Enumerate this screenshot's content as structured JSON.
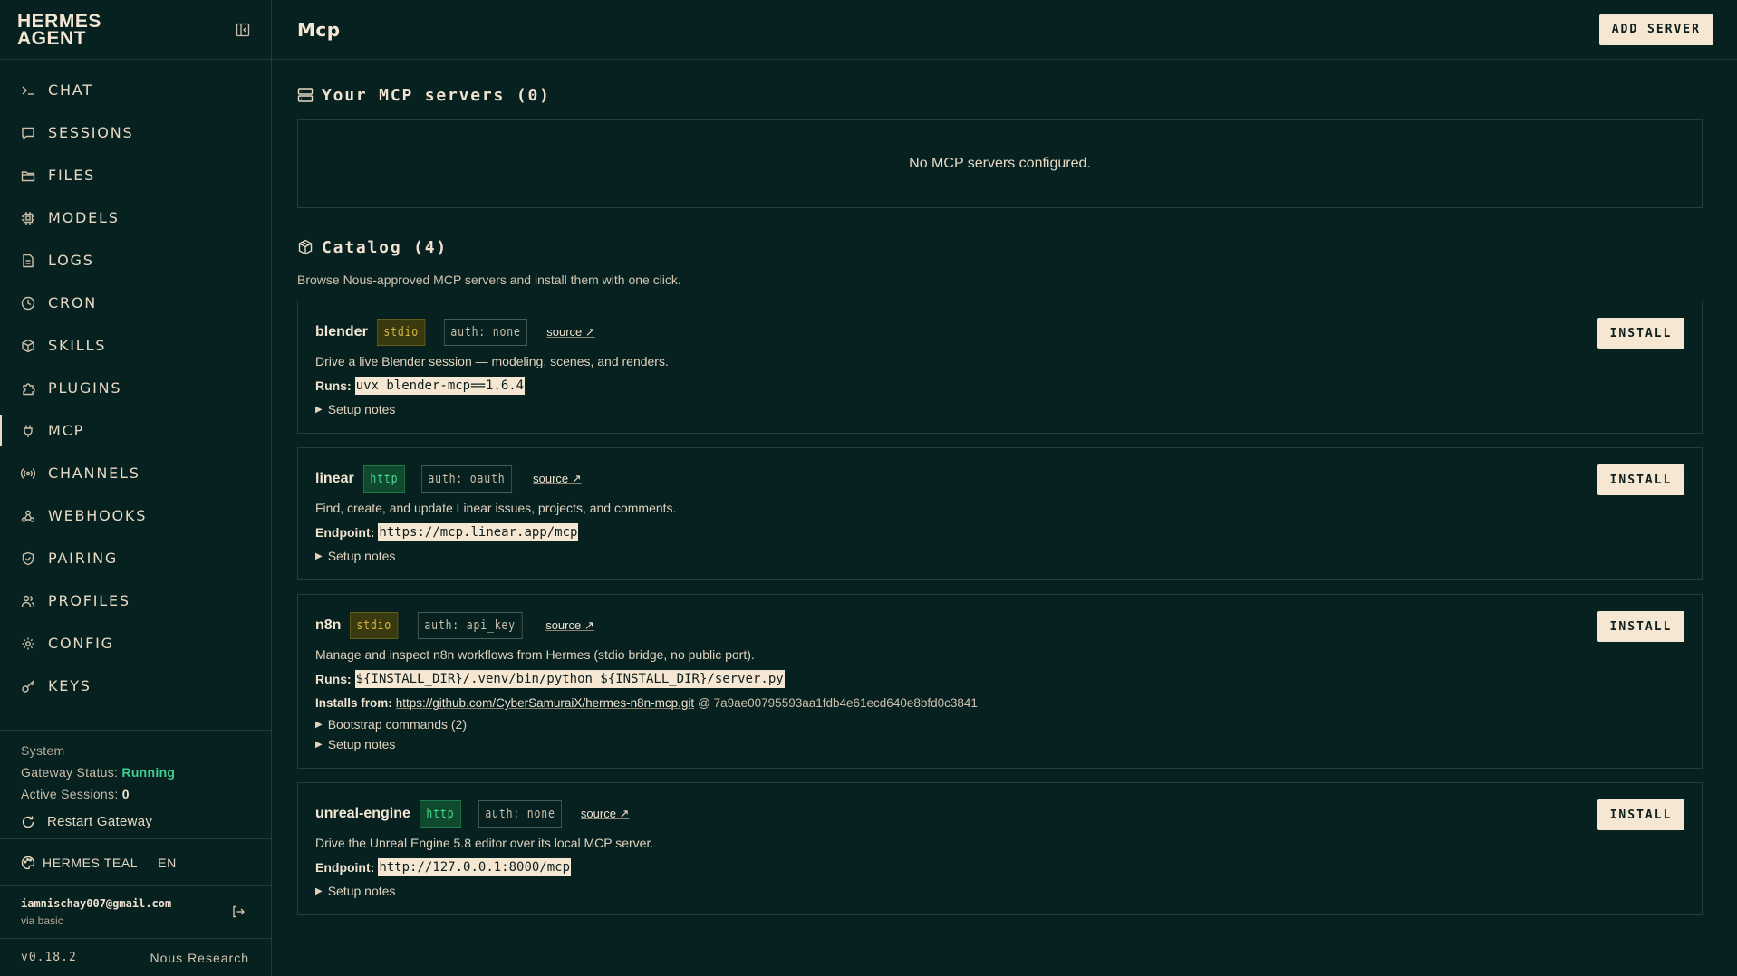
{
  "brand": {
    "title": "HERMES\nAGENT"
  },
  "nav": [
    {
      "label": "CHAT",
      "icon": "terminal-icon",
      "active": false
    },
    {
      "label": "SESSIONS",
      "icon": "message-icon",
      "active": false
    },
    {
      "label": "FILES",
      "icon": "folder-icon",
      "active": false
    },
    {
      "label": "MODELS",
      "icon": "cpu-icon",
      "active": false
    },
    {
      "label": "LOGS",
      "icon": "file-text-icon",
      "active": false
    },
    {
      "label": "CRON",
      "icon": "clock-icon",
      "active": false
    },
    {
      "label": "SKILLS",
      "icon": "package-icon",
      "active": false
    },
    {
      "label": "PLUGINS",
      "icon": "puzzle-icon",
      "active": false
    },
    {
      "label": "MCP",
      "icon": "plug-icon",
      "active": true
    },
    {
      "label": "CHANNELS",
      "icon": "radio-icon",
      "active": false
    },
    {
      "label": "WEBHOOKS",
      "icon": "webhook-icon",
      "active": false
    },
    {
      "label": "PAIRING",
      "icon": "shield-icon",
      "active": false
    },
    {
      "label": "PROFILES",
      "icon": "users-icon",
      "active": false
    },
    {
      "label": "CONFIG",
      "icon": "gear-icon",
      "active": false
    },
    {
      "label": "KEYS",
      "icon": "key-icon",
      "active": false
    }
  ],
  "system": {
    "title": "System",
    "gateway_label": "Gateway Status:",
    "gateway_value": "Running",
    "sessions_label": "Active Sessions:",
    "sessions_value": "0",
    "restart_label": "Restart Gateway"
  },
  "theme": {
    "name": "HERMES TEAL",
    "lang": "EN"
  },
  "user": {
    "email": "iamnischay007@gmail.com",
    "auth": "via basic"
  },
  "footer": {
    "version": "v0.18.2",
    "org": "Nous Research"
  },
  "header": {
    "title": "Mcp",
    "add_button": "ADD SERVER"
  },
  "servers": {
    "title": "Your MCP servers (0)",
    "empty": "No MCP servers configured."
  },
  "catalog": {
    "title": "Catalog (4)",
    "description": "Browse Nous-approved MCP servers and install them with one click.",
    "install_label": "INSTALL",
    "source_label": "source ↗",
    "setup_label": "Setup notes",
    "items": [
      {
        "name": "blender",
        "transport": "stdio",
        "auth": "auth: none",
        "description": "Drive a live Blender session — modeling, scenes, and renders.",
        "line_label": "Runs:",
        "line_value": "uvx blender-mcp==1.6.4"
      },
      {
        "name": "linear",
        "transport": "http",
        "auth": "auth: oauth",
        "description": "Find, create, and update Linear issues, projects, and comments.",
        "line_label": "Endpoint:",
        "line_value": "https://mcp.linear.app/mcp"
      },
      {
        "name": "n8n",
        "transport": "stdio",
        "auth": "auth: api_key",
        "description": "Manage and inspect n8n workflows from Hermes (stdio bridge, no public port).",
        "line_label": "Runs:",
        "line_value": "${INSTALL_DIR}/.venv/bin/python ${INSTALL_DIR}/server.py",
        "installs_label": "Installs from:",
        "installs_url": "https://github.com/CyberSamuraiX/hermes-n8n-mcp.git",
        "installs_commit": "@ 7a9ae00795593aa1fdb4e61ecd640e8bfd0c3841",
        "bootstrap_label": "Bootstrap commands (2)"
      },
      {
        "name": "unreal-engine",
        "transport": "http",
        "auth": "auth: none",
        "description": "Drive the Unreal Engine 5.8 editor over its local MCP server.",
        "line_label": "Endpoint:",
        "line_value": "http://127.0.0.1:8000/mcp"
      }
    ]
  },
  "colors": {
    "background": "#062120",
    "text": "#f0e2cf",
    "accent_light": "#f6e7d2",
    "running": "#3fcf8e",
    "stdio": "#d6b341",
    "http": "#47d88f"
  }
}
